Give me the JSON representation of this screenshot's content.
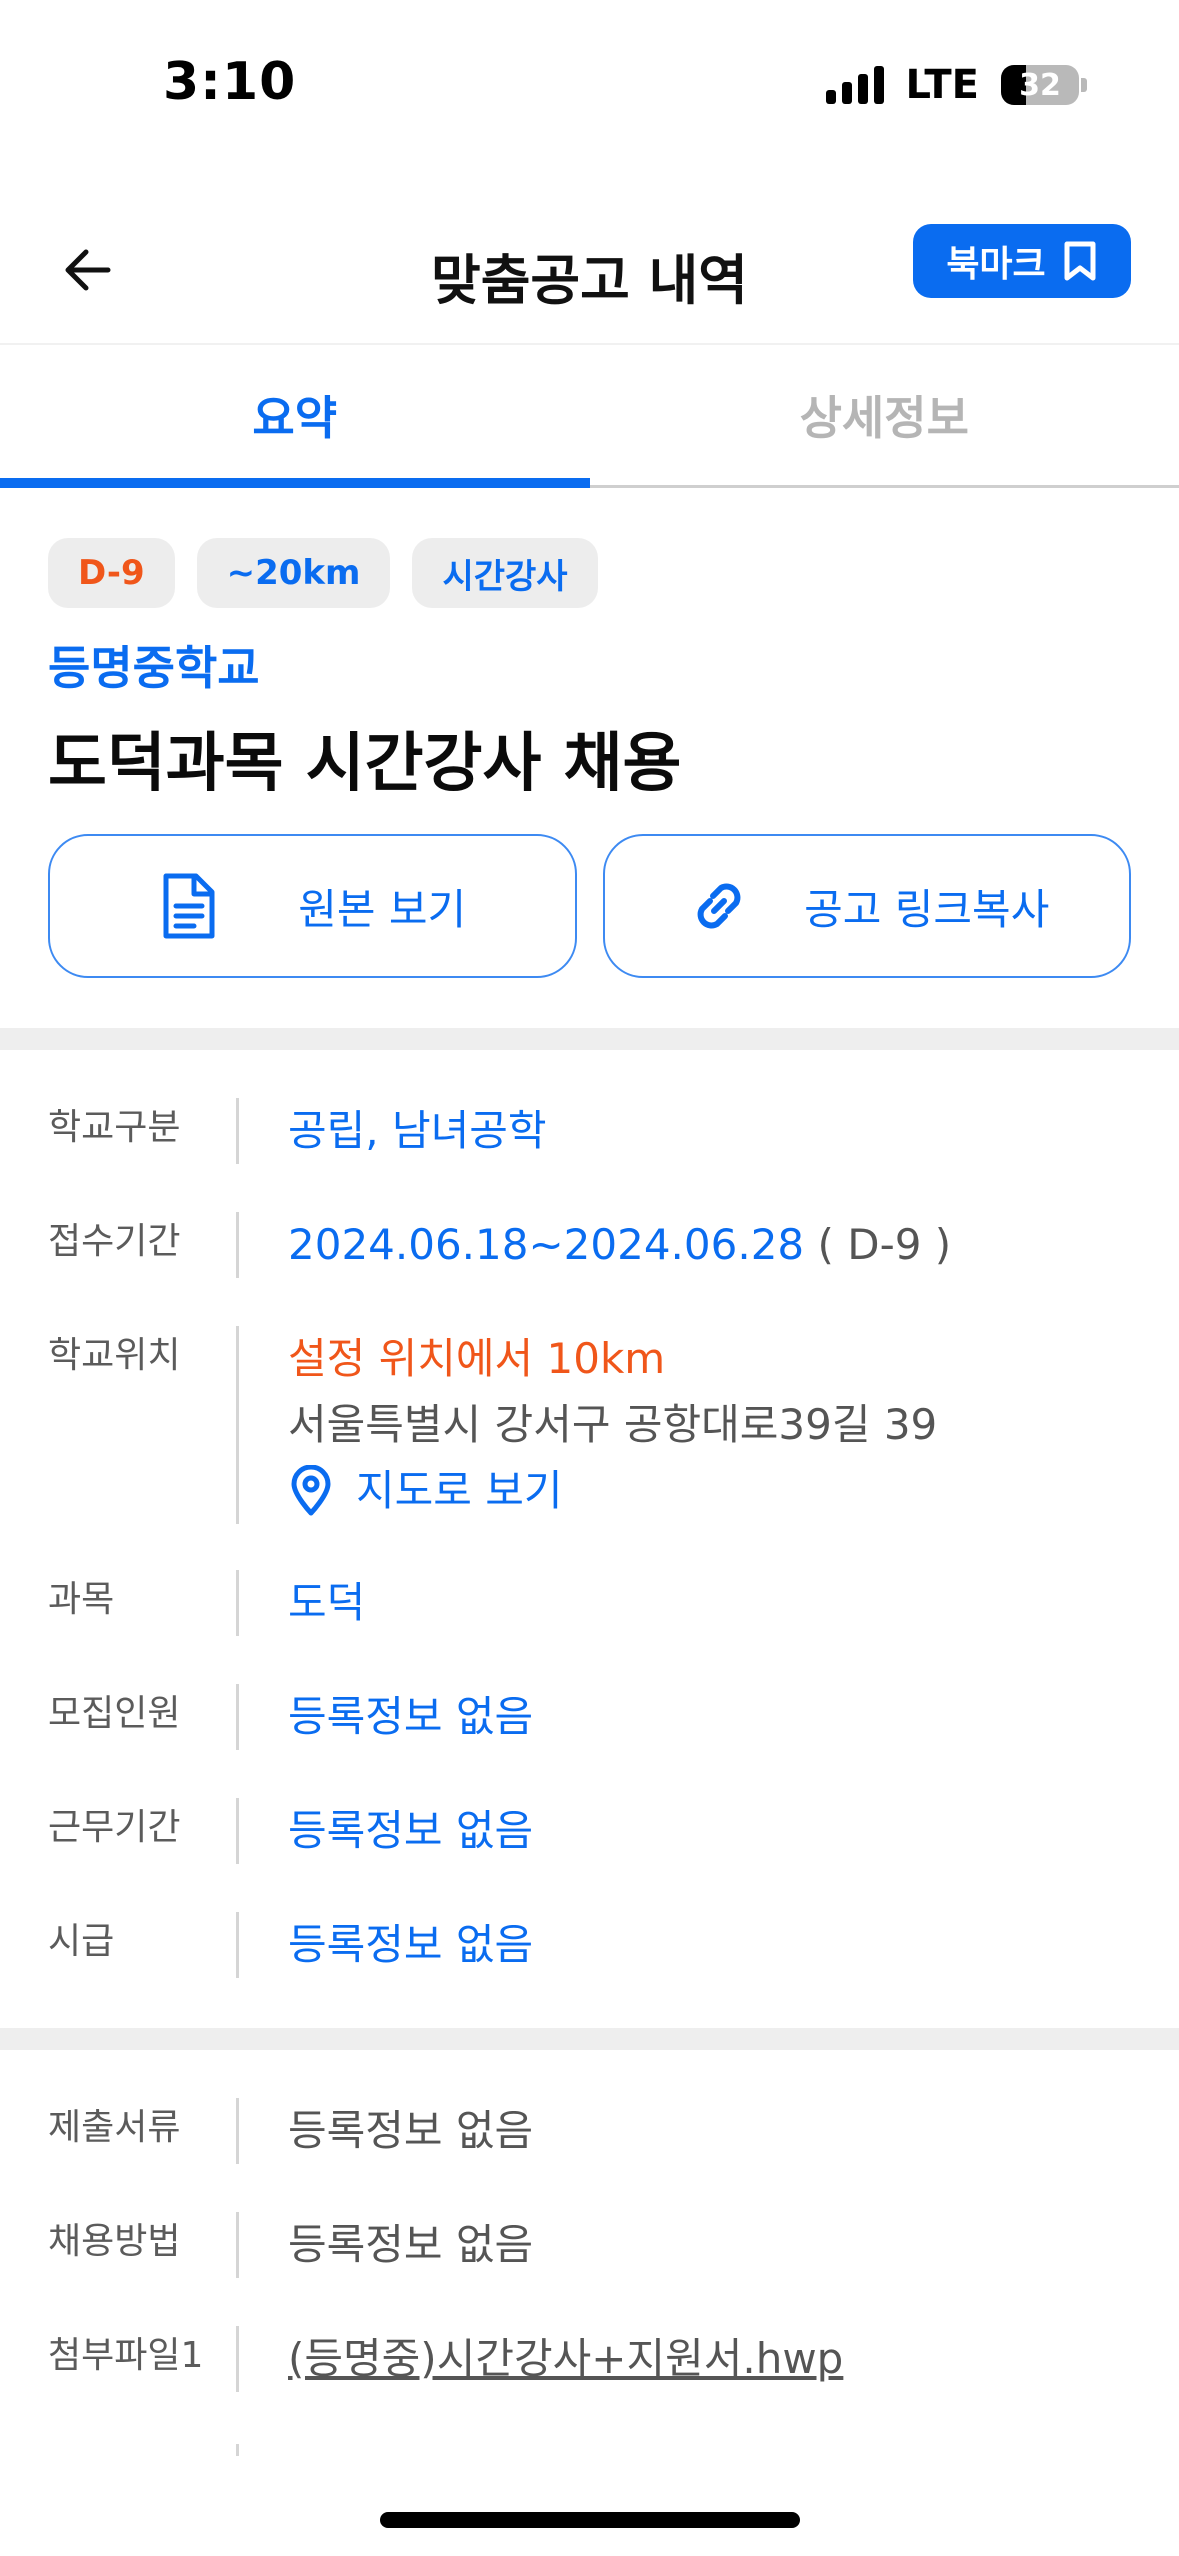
{
  "status_bar": {
    "time": "3:10",
    "network": "LTE",
    "battery": "32",
    "battery_level_percent": 32
  },
  "header": {
    "title": "맞춤공고 내역",
    "back_icon": "arrow-left-icon",
    "bookmark_label": "북마크",
    "bookmark_icon": "bookmark-icon"
  },
  "tabs": [
    {
      "label": "요약",
      "active": true
    },
    {
      "label": "상세정보",
      "active": false
    }
  ],
  "chips": {
    "dday": "D-9",
    "distance": "~20km",
    "type": "시간강사"
  },
  "job": {
    "school": "등명중학교",
    "title": "도덕과목 시간강사 채용"
  },
  "actions": {
    "view_original": "원본 보기",
    "view_original_icon": "document-icon",
    "copy_link": "공고 링크복사",
    "copy_link_icon": "link-icon"
  },
  "info": {
    "school_type": {
      "label": "학교구분",
      "value": "공립, 남녀공학"
    },
    "period": {
      "label": "접수기간",
      "value": "2024.06.18~2024.06.28",
      "dday": "( D-9 )"
    },
    "location": {
      "label": "학교위치",
      "distance": "설정 위치에서 10km",
      "address": "서울특별시 강서구 공항대로39길 39",
      "map_link": "지도로 보기",
      "map_icon": "location-pin-icon"
    },
    "subject": {
      "label": "과목",
      "value": "도덕"
    },
    "recruits": {
      "label": "모집인원",
      "value": "등록정보 없음"
    },
    "work_period": {
      "label": "근무기간",
      "value": "등록정보 없음"
    },
    "pay": {
      "label": "시급",
      "value": "등록정보 없음"
    }
  },
  "extra": {
    "documents": {
      "label": "제출서류",
      "value": "등록정보 없음"
    },
    "method": {
      "label": "채용방법",
      "value": "등록정보 없음"
    },
    "attachment1": {
      "label": "첨부파일1",
      "value": "(등명중)시간강사+지원서.hwp"
    }
  },
  "colors": {
    "accent": "#0a6cf0",
    "dday": "#f0561a",
    "chip_bg": "#ededed",
    "divider": "#eeeeee"
  }
}
